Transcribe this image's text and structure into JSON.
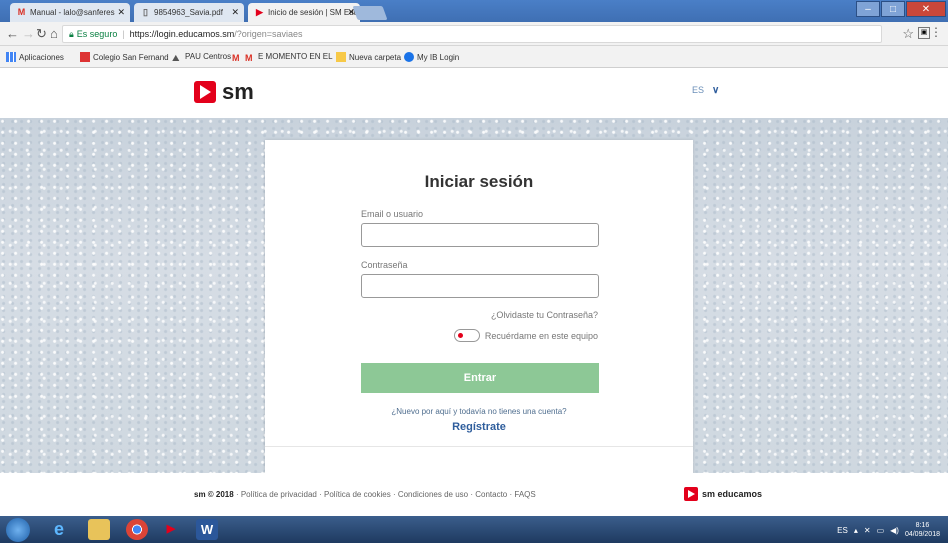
{
  "browser": {
    "tabs": [
      {
        "label": "Manual - lalo@sanferes",
        "icon": "gmail-icon"
      },
      {
        "label": "9854963_Savia.pdf",
        "icon": "pdf-icon"
      },
      {
        "label": "Inicio de sesión | SM Edu",
        "icon": "sm-icon"
      }
    ],
    "secure_label": "Es seguro",
    "url_main": "https://login.educamos.sm",
    "url_rest": "/?origen=saviaes",
    "bookmarks": [
      {
        "label": "Aplicaciones"
      },
      {
        "label": "Colegio San Fernand"
      },
      {
        "label": "PAU Centros"
      },
      {
        "label": "E MOMENTO EN EL"
      },
      {
        "label": "Nueva carpeta"
      },
      {
        "label": "My IB Login"
      }
    ]
  },
  "site": {
    "logo_text": "sm",
    "language": "ES"
  },
  "login": {
    "title": "Iniciar sesión",
    "email_label": "Email o usuario",
    "email_value": "",
    "password_label": "Contraseña",
    "password_value": "",
    "forgot_link": "¿Olvidaste tu Contraseña?",
    "remember_label": "Recuérdame en este equipo",
    "submit_label": "Entrar",
    "new_user_text": "¿Nuevo por aquí y todavía no tienes una cuenta?",
    "register_link": "Regístrate"
  },
  "footer": {
    "copyright": "sm © 2018",
    "links": [
      "Política de privacidad",
      "Política de cookies",
      "Condiciones de uso",
      "Contacto",
      "FAQS"
    ],
    "brand": "sm educamos"
  },
  "taskbar": {
    "language": "ES",
    "time": "8:16",
    "date": "04/09/2018"
  },
  "colors": {
    "brand_red": "#e3001b",
    "button_green": "#8dc896",
    "link_blue": "#2e5d9c"
  }
}
